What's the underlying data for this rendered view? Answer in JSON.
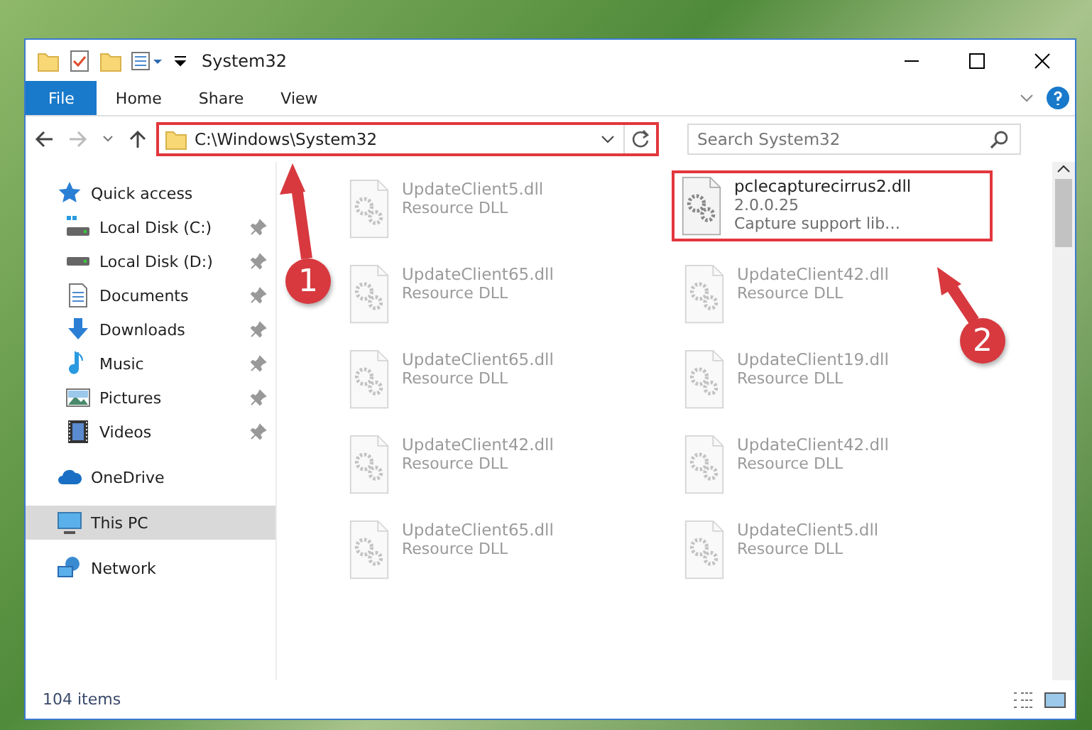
{
  "window": {
    "title": "System32"
  },
  "ribbon": {
    "tabs": [
      {
        "label": "File",
        "selected": true
      },
      {
        "label": "Home",
        "selected": false
      },
      {
        "label": "Share",
        "selected": false
      },
      {
        "label": "View",
        "selected": false
      }
    ]
  },
  "address_bar": {
    "path": "C:\\Windows\\System32",
    "highlighted": true
  },
  "search": {
    "placeholder": "Search System32"
  },
  "sidebar": {
    "items": [
      {
        "label": "Quick access",
        "kind": "star",
        "selected": false,
        "children": [
          {
            "label": "Local Disk (C:)",
            "kind": "system-drive",
            "pinned": true
          },
          {
            "label": "Local Disk (D:)",
            "kind": "drive",
            "pinned": true
          },
          {
            "label": "Documents",
            "kind": "document",
            "pinned": true
          },
          {
            "label": "Downloads",
            "kind": "download",
            "pinned": true
          },
          {
            "label": "Music",
            "kind": "music",
            "pinned": true
          },
          {
            "label": "Pictures",
            "kind": "picture",
            "pinned": true
          },
          {
            "label": "Videos",
            "kind": "video",
            "pinned": true
          }
        ]
      },
      {
        "label": "OneDrive",
        "kind": "cloud",
        "selected": false
      },
      {
        "label": "This PC",
        "kind": "monitor",
        "selected": true
      },
      {
        "label": "Network",
        "kind": "network",
        "selected": false
      }
    ]
  },
  "files": [
    {
      "name": "UpdateClient5.dll",
      "type": "Resource DLL",
      "dimmed": true
    },
    {
      "name": "pclecapturecirrus2.dll",
      "version": "2.0.0.25",
      "type": "Capture support lib…",
      "dimmed": false,
      "highlighted": true
    },
    {
      "name": "UpdateClient65.dll",
      "type": "Resource DLL",
      "dimmed": true
    },
    {
      "name": "UpdateClient42.dll",
      "type": "Resource DLL",
      "dimmed": true
    },
    {
      "name": "UpdateClient65.dll",
      "type": "Resource DLL",
      "dimmed": true
    },
    {
      "name": "UpdateClient19.dll",
      "type": "Resource DLL",
      "dimmed": true
    },
    {
      "name": "UpdateClient42.dll",
      "type": "Resource DLL",
      "dimmed": true
    },
    {
      "name": "UpdateClient42.dll",
      "type": "Resource DLL",
      "dimmed": true
    },
    {
      "name": "UpdateClient65.dll",
      "type": "Resource DLL",
      "dimmed": true
    },
    {
      "name": "UpdateClient5.dll",
      "type": "Resource DLL",
      "dimmed": true
    }
  ],
  "status_bar": {
    "count": "104 items"
  },
  "annotations": [
    {
      "label": "1"
    },
    {
      "label": "2"
    }
  ]
}
